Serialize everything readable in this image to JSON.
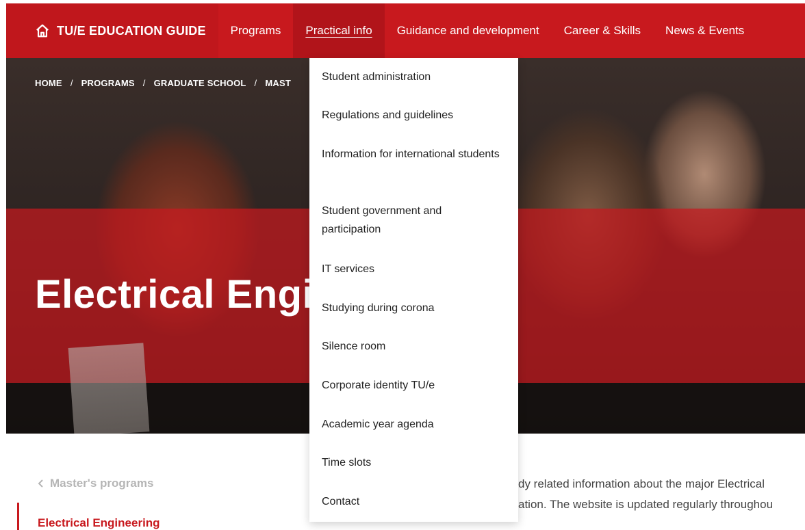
{
  "header": {
    "brand": "TU/E EDUCATION GUIDE",
    "brand_icon": "home-icon",
    "nav": [
      {
        "label": "Programs"
      },
      {
        "label": "Practical info",
        "active": true
      },
      {
        "label": "Guidance and development"
      },
      {
        "label": "Career & Skills"
      },
      {
        "label": "News & Events"
      }
    ]
  },
  "breadcrumb": [
    "HOME",
    "PROGRAMS",
    "GRADUATE SCHOOL",
    "MAST"
  ],
  "hero": {
    "title": "Electrical Engi"
  },
  "dropdown": {
    "items": [
      {
        "label": "Student administration"
      },
      {
        "label": "Regulations and guidelines"
      },
      {
        "label": "Information for international students"
      },
      {
        "label": "Student government and participation"
      },
      {
        "label": "IT services"
      },
      {
        "label": "Studying during corona"
      },
      {
        "label": "Silence room"
      },
      {
        "label": "Corporate identity TU/e"
      },
      {
        "label": "Academic year agenda"
      },
      {
        "label": "Time slots"
      },
      {
        "label": "Contact"
      }
    ]
  },
  "sidebar": {
    "back_link": "Master's programs",
    "active_item": "Electrical Engineering"
  },
  "content": {
    "line1": "dy related information about the major Electrical",
    "line2": "ation. The website is updated regularly throughou"
  },
  "colors": {
    "brand_red": "#c8191e"
  }
}
